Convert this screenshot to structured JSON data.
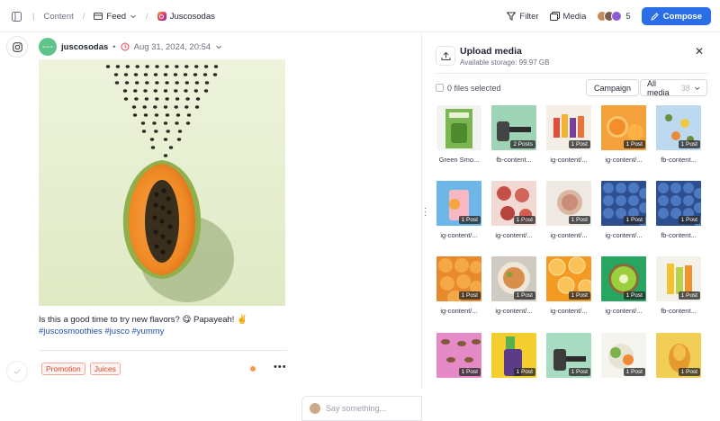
{
  "topbar": {
    "crumb_content": "Content",
    "crumb_feed": "Feed",
    "crumb_account": "Juscosodas",
    "filter": "Filter",
    "media": "Media",
    "member_count": "5",
    "compose": "Compose"
  },
  "post": {
    "account": "juscosodas",
    "date": "Aug 31, 2024, 20:54",
    "caption": "Is this a good time to try new flavors? 😋 Papayeah! ✌️",
    "hashtags": "#juscosmoothies #jusco #yummy",
    "labels": [
      "Promotion",
      "Juices"
    ],
    "comment_placeholder": "Say something..."
  },
  "panel": {
    "title": "Upload media",
    "storage": "Available storage: 99.97 GB",
    "selected": "0 files selected",
    "campaign": "Campaign",
    "filter_label": "All media",
    "filter_count": "38"
  },
  "media": [
    {
      "name": "Green Smo...",
      "badge": "",
      "kind": "card"
    },
    {
      "name": "fb-content...",
      "badge": "2 Posts",
      "kind": "mint"
    },
    {
      "name": "ig-content/...",
      "badge": "1 Post",
      "kind": "bottles"
    },
    {
      "name": "ig-content/...",
      "badge": "1 Post",
      "kind": "orange"
    },
    {
      "name": "fb-content...",
      "badge": "1 Post",
      "kind": "skyfruit"
    },
    {
      "name": "ig-content/...",
      "badge": "1 Post",
      "kind": "drink"
    },
    {
      "name": "ig-content/...",
      "badge": "1 Post",
      "kind": "figs"
    },
    {
      "name": "ig-content/...",
      "badge": "1 Post",
      "kind": "bowl"
    },
    {
      "name": "ig-content/...",
      "badge": "1 Post",
      "kind": "berries"
    },
    {
      "name": "fb-content...",
      "badge": "1 Post",
      "kind": "berries"
    },
    {
      "name": "ig-content/...",
      "badge": "1 Post",
      "kind": "apricot"
    },
    {
      "name": "ig-content/...",
      "badge": "1 Post",
      "kind": "plate"
    },
    {
      "name": "ig-content/...",
      "badge": "1 Post",
      "kind": "citrus"
    },
    {
      "name": "ig-content/...",
      "badge": "1 Post",
      "kind": "kiwi"
    },
    {
      "name": "fb-content...",
      "badge": "1 Post",
      "kind": "bottles2"
    },
    {
      "name": "",
      "badge": "1 Post",
      "kind": "pink"
    },
    {
      "name": "",
      "badge": "1 Post",
      "kind": "yellowcan"
    },
    {
      "name": "",
      "badge": "1 Post",
      "kind": "mint2"
    },
    {
      "name": "",
      "badge": "1 Post",
      "kind": "veg"
    },
    {
      "name": "",
      "badge": "1 Post",
      "kind": "mango"
    }
  ]
}
